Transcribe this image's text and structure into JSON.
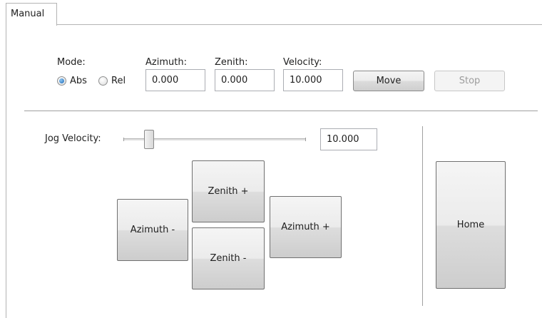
{
  "tabs": [
    {
      "label": "Manual",
      "selected": true
    }
  ],
  "move": {
    "mode_label": "Mode:",
    "mode_options": [
      {
        "label": "Abs",
        "selected": true
      },
      {
        "label": "Rel",
        "selected": false
      }
    ],
    "azimuth": {
      "label": "Azimuth:",
      "value": "0.000"
    },
    "zenith": {
      "label": "Zenith:",
      "value": "0.000"
    },
    "velocity": {
      "label": "Velocity:",
      "value": "10.000"
    },
    "move_button": "Move",
    "stop_button": {
      "label": "Stop",
      "enabled": false
    }
  },
  "jog": {
    "velocity_label": "Jog Velocity:",
    "velocity_value": "10.000",
    "slider_fraction": 0.12,
    "zenith_plus": "Zenith +",
    "zenith_minus": "Zenith -",
    "azimuth_minus": "Azimuth -",
    "azimuth_plus": "Azimuth +",
    "home": "Home"
  },
  "colors": {
    "radio_selected": "#1a66b8",
    "border": "#b4b4b4",
    "disabled_text": "#9d9d9d"
  }
}
